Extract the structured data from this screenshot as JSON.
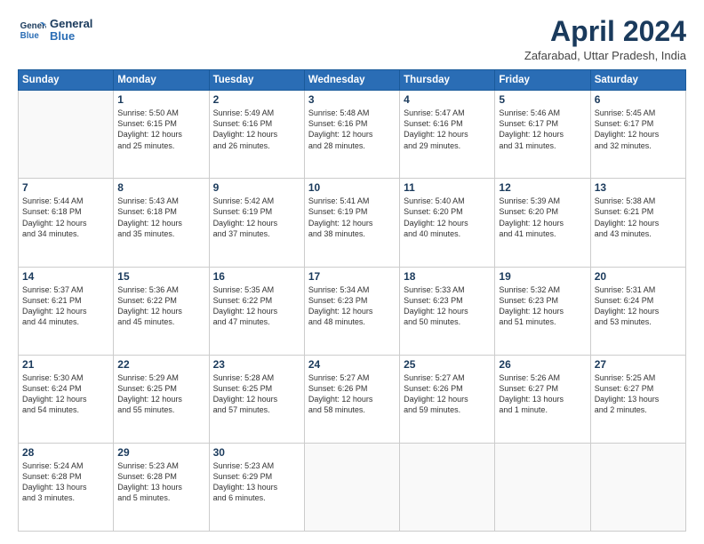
{
  "logo": {
    "line1": "General",
    "line2": "Blue"
  },
  "title": "April 2024",
  "subtitle": "Zafarabad, Uttar Pradesh, India",
  "days_header": [
    "Sunday",
    "Monday",
    "Tuesday",
    "Wednesday",
    "Thursday",
    "Friday",
    "Saturday"
  ],
  "weeks": [
    [
      {
        "num": "",
        "info": ""
      },
      {
        "num": "1",
        "info": "Sunrise: 5:50 AM\nSunset: 6:15 PM\nDaylight: 12 hours\nand 25 minutes."
      },
      {
        "num": "2",
        "info": "Sunrise: 5:49 AM\nSunset: 6:16 PM\nDaylight: 12 hours\nand 26 minutes."
      },
      {
        "num": "3",
        "info": "Sunrise: 5:48 AM\nSunset: 6:16 PM\nDaylight: 12 hours\nand 28 minutes."
      },
      {
        "num": "4",
        "info": "Sunrise: 5:47 AM\nSunset: 6:16 PM\nDaylight: 12 hours\nand 29 minutes."
      },
      {
        "num": "5",
        "info": "Sunrise: 5:46 AM\nSunset: 6:17 PM\nDaylight: 12 hours\nand 31 minutes."
      },
      {
        "num": "6",
        "info": "Sunrise: 5:45 AM\nSunset: 6:17 PM\nDaylight: 12 hours\nand 32 minutes."
      }
    ],
    [
      {
        "num": "7",
        "info": "Sunrise: 5:44 AM\nSunset: 6:18 PM\nDaylight: 12 hours\nand 34 minutes."
      },
      {
        "num": "8",
        "info": "Sunrise: 5:43 AM\nSunset: 6:18 PM\nDaylight: 12 hours\nand 35 minutes."
      },
      {
        "num": "9",
        "info": "Sunrise: 5:42 AM\nSunset: 6:19 PM\nDaylight: 12 hours\nand 37 minutes."
      },
      {
        "num": "10",
        "info": "Sunrise: 5:41 AM\nSunset: 6:19 PM\nDaylight: 12 hours\nand 38 minutes."
      },
      {
        "num": "11",
        "info": "Sunrise: 5:40 AM\nSunset: 6:20 PM\nDaylight: 12 hours\nand 40 minutes."
      },
      {
        "num": "12",
        "info": "Sunrise: 5:39 AM\nSunset: 6:20 PM\nDaylight: 12 hours\nand 41 minutes."
      },
      {
        "num": "13",
        "info": "Sunrise: 5:38 AM\nSunset: 6:21 PM\nDaylight: 12 hours\nand 43 minutes."
      }
    ],
    [
      {
        "num": "14",
        "info": "Sunrise: 5:37 AM\nSunset: 6:21 PM\nDaylight: 12 hours\nand 44 minutes."
      },
      {
        "num": "15",
        "info": "Sunrise: 5:36 AM\nSunset: 6:22 PM\nDaylight: 12 hours\nand 45 minutes."
      },
      {
        "num": "16",
        "info": "Sunrise: 5:35 AM\nSunset: 6:22 PM\nDaylight: 12 hours\nand 47 minutes."
      },
      {
        "num": "17",
        "info": "Sunrise: 5:34 AM\nSunset: 6:23 PM\nDaylight: 12 hours\nand 48 minutes."
      },
      {
        "num": "18",
        "info": "Sunrise: 5:33 AM\nSunset: 6:23 PM\nDaylight: 12 hours\nand 50 minutes."
      },
      {
        "num": "19",
        "info": "Sunrise: 5:32 AM\nSunset: 6:23 PM\nDaylight: 12 hours\nand 51 minutes."
      },
      {
        "num": "20",
        "info": "Sunrise: 5:31 AM\nSunset: 6:24 PM\nDaylight: 12 hours\nand 53 minutes."
      }
    ],
    [
      {
        "num": "21",
        "info": "Sunrise: 5:30 AM\nSunset: 6:24 PM\nDaylight: 12 hours\nand 54 minutes."
      },
      {
        "num": "22",
        "info": "Sunrise: 5:29 AM\nSunset: 6:25 PM\nDaylight: 12 hours\nand 55 minutes."
      },
      {
        "num": "23",
        "info": "Sunrise: 5:28 AM\nSunset: 6:25 PM\nDaylight: 12 hours\nand 57 minutes."
      },
      {
        "num": "24",
        "info": "Sunrise: 5:27 AM\nSunset: 6:26 PM\nDaylight: 12 hours\nand 58 minutes."
      },
      {
        "num": "25",
        "info": "Sunrise: 5:27 AM\nSunset: 6:26 PM\nDaylight: 12 hours\nand 59 minutes."
      },
      {
        "num": "26",
        "info": "Sunrise: 5:26 AM\nSunset: 6:27 PM\nDaylight: 13 hours\nand 1 minute."
      },
      {
        "num": "27",
        "info": "Sunrise: 5:25 AM\nSunset: 6:27 PM\nDaylight: 13 hours\nand 2 minutes."
      }
    ],
    [
      {
        "num": "28",
        "info": "Sunrise: 5:24 AM\nSunset: 6:28 PM\nDaylight: 13 hours\nand 3 minutes."
      },
      {
        "num": "29",
        "info": "Sunrise: 5:23 AM\nSunset: 6:28 PM\nDaylight: 13 hours\nand 5 minutes."
      },
      {
        "num": "30",
        "info": "Sunrise: 5:23 AM\nSunset: 6:29 PM\nDaylight: 13 hours\nand 6 minutes."
      },
      {
        "num": "",
        "info": ""
      },
      {
        "num": "",
        "info": ""
      },
      {
        "num": "",
        "info": ""
      },
      {
        "num": "",
        "info": ""
      }
    ]
  ]
}
